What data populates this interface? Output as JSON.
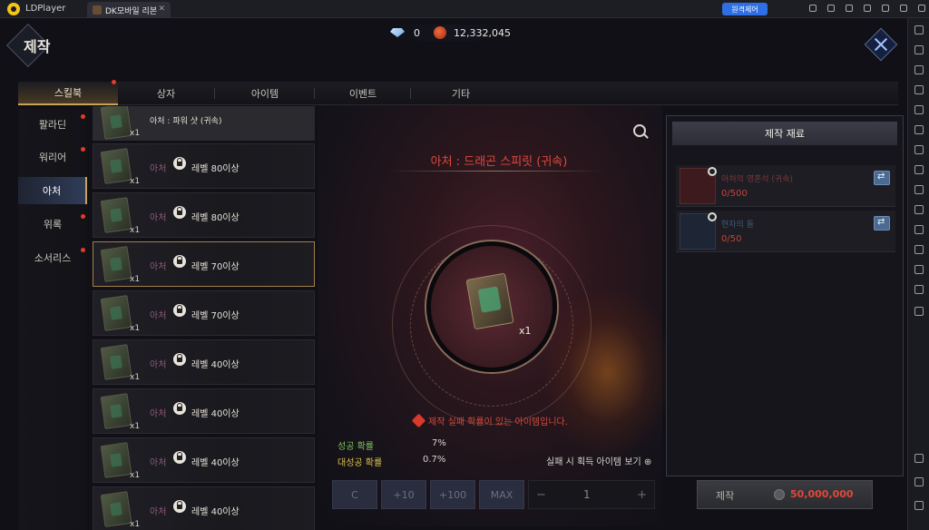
{
  "emulator": {
    "app_name": "LDPlayer",
    "tab_title": "DK모바일 리본",
    "sync_button": "원격제어"
  },
  "game": {
    "page_title": "제작",
    "currency": {
      "gems": "0",
      "gold": "12,332,045"
    },
    "category_tabs": [
      "스킬북",
      "상자",
      "아이템",
      "이벤트",
      "기타"
    ],
    "active_tab": "스킬북",
    "classes": [
      "팔라딘",
      "워리어",
      "아처",
      "위록",
      "소서리스"
    ],
    "active_class": "아처",
    "recipes": [
      {
        "name": "아처 : 파워 샷 (귀속)",
        "qty": "x1"
      },
      {
        "prefix": "아처",
        "level": "레벨 80이상",
        "qty": "x1"
      },
      {
        "prefix": "아처",
        "level": "레벨 80이상",
        "qty": "x1"
      },
      {
        "prefix": "아처",
        "level": "레벨 70이상",
        "qty": "x1"
      },
      {
        "prefix": "아처",
        "level": "레벨 70이상",
        "qty": "x1"
      },
      {
        "prefix": "아처",
        "level": "레벨 40이상",
        "qty": "x1"
      },
      {
        "prefix": "아처",
        "level": "레벨 40이상",
        "qty": "x1"
      },
      {
        "prefix": "아처",
        "level": "레벨 40이상",
        "qty": "x1"
      },
      {
        "prefix": "아처",
        "level": "레벨 40이상",
        "qty": "x1"
      }
    ],
    "detail": {
      "item_title": "아처 : 드래곤 스피릿 (귀속)",
      "item_qty": "x1",
      "warning": "제작 실패 확률이 있는 아이템입니다.",
      "success_label": "성공 확률",
      "success_value": "7%",
      "great_label": "대성공 확률",
      "great_value": "0.7%",
      "fail_view": "실패 시 획득 아이템 보기"
    },
    "quantity_buttons": [
      "C",
      "+10",
      "+100",
      "MAX"
    ],
    "stepper": {
      "minus": "−",
      "plus": "+",
      "value": "1"
    },
    "materials": {
      "header": "제작 재료",
      "items": [
        {
          "name": "아처의 영혼석 (귀속)",
          "count": "0/500"
        },
        {
          "name": "현자의 돌",
          "count": "0/50"
        }
      ]
    },
    "craft": {
      "label": "제작",
      "cost": "50,000,000"
    },
    "colors": {
      "accent_gold": "#c8a35a",
      "warning_red": "#e0483c",
      "success_green": "#7cc35a",
      "great_yellow": "#d9c04a"
    }
  }
}
